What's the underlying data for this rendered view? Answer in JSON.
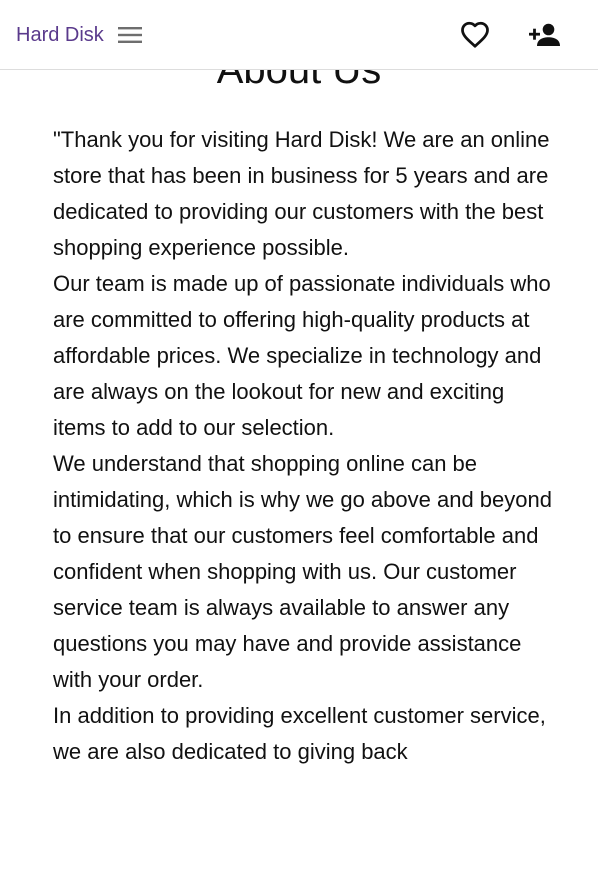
{
  "navbar": {
    "brand": "Hard Disk",
    "menu_icon": "hamburger-menu-icon",
    "favorites_icon": "heart-outline-icon",
    "add_user_icon": "person-add-icon",
    "brand_color": "#5a3a8c"
  },
  "main": {
    "title": "About Us",
    "paragraphs": [
      "\"Thank you for visiting Hard Disk! We are an online store that has been in business for 5 years and are dedicated to providing our customers with the best shopping experience possible.",
      "Our team is made up of passionate individuals who are committed to offering high-quality products at affordable prices. We specialize in technology and are always on the lookout for new and exciting items to add to our selection.",
      "We understand that shopping online can be intimidating, which is why we go above and beyond to ensure that our customers feel comfortable and confident when shopping with us. Our customer service team is always available to answer any questions you may have and provide assistance with your order.",
      "In addition to providing excellent customer service, we are also dedicated to giving back"
    ]
  }
}
